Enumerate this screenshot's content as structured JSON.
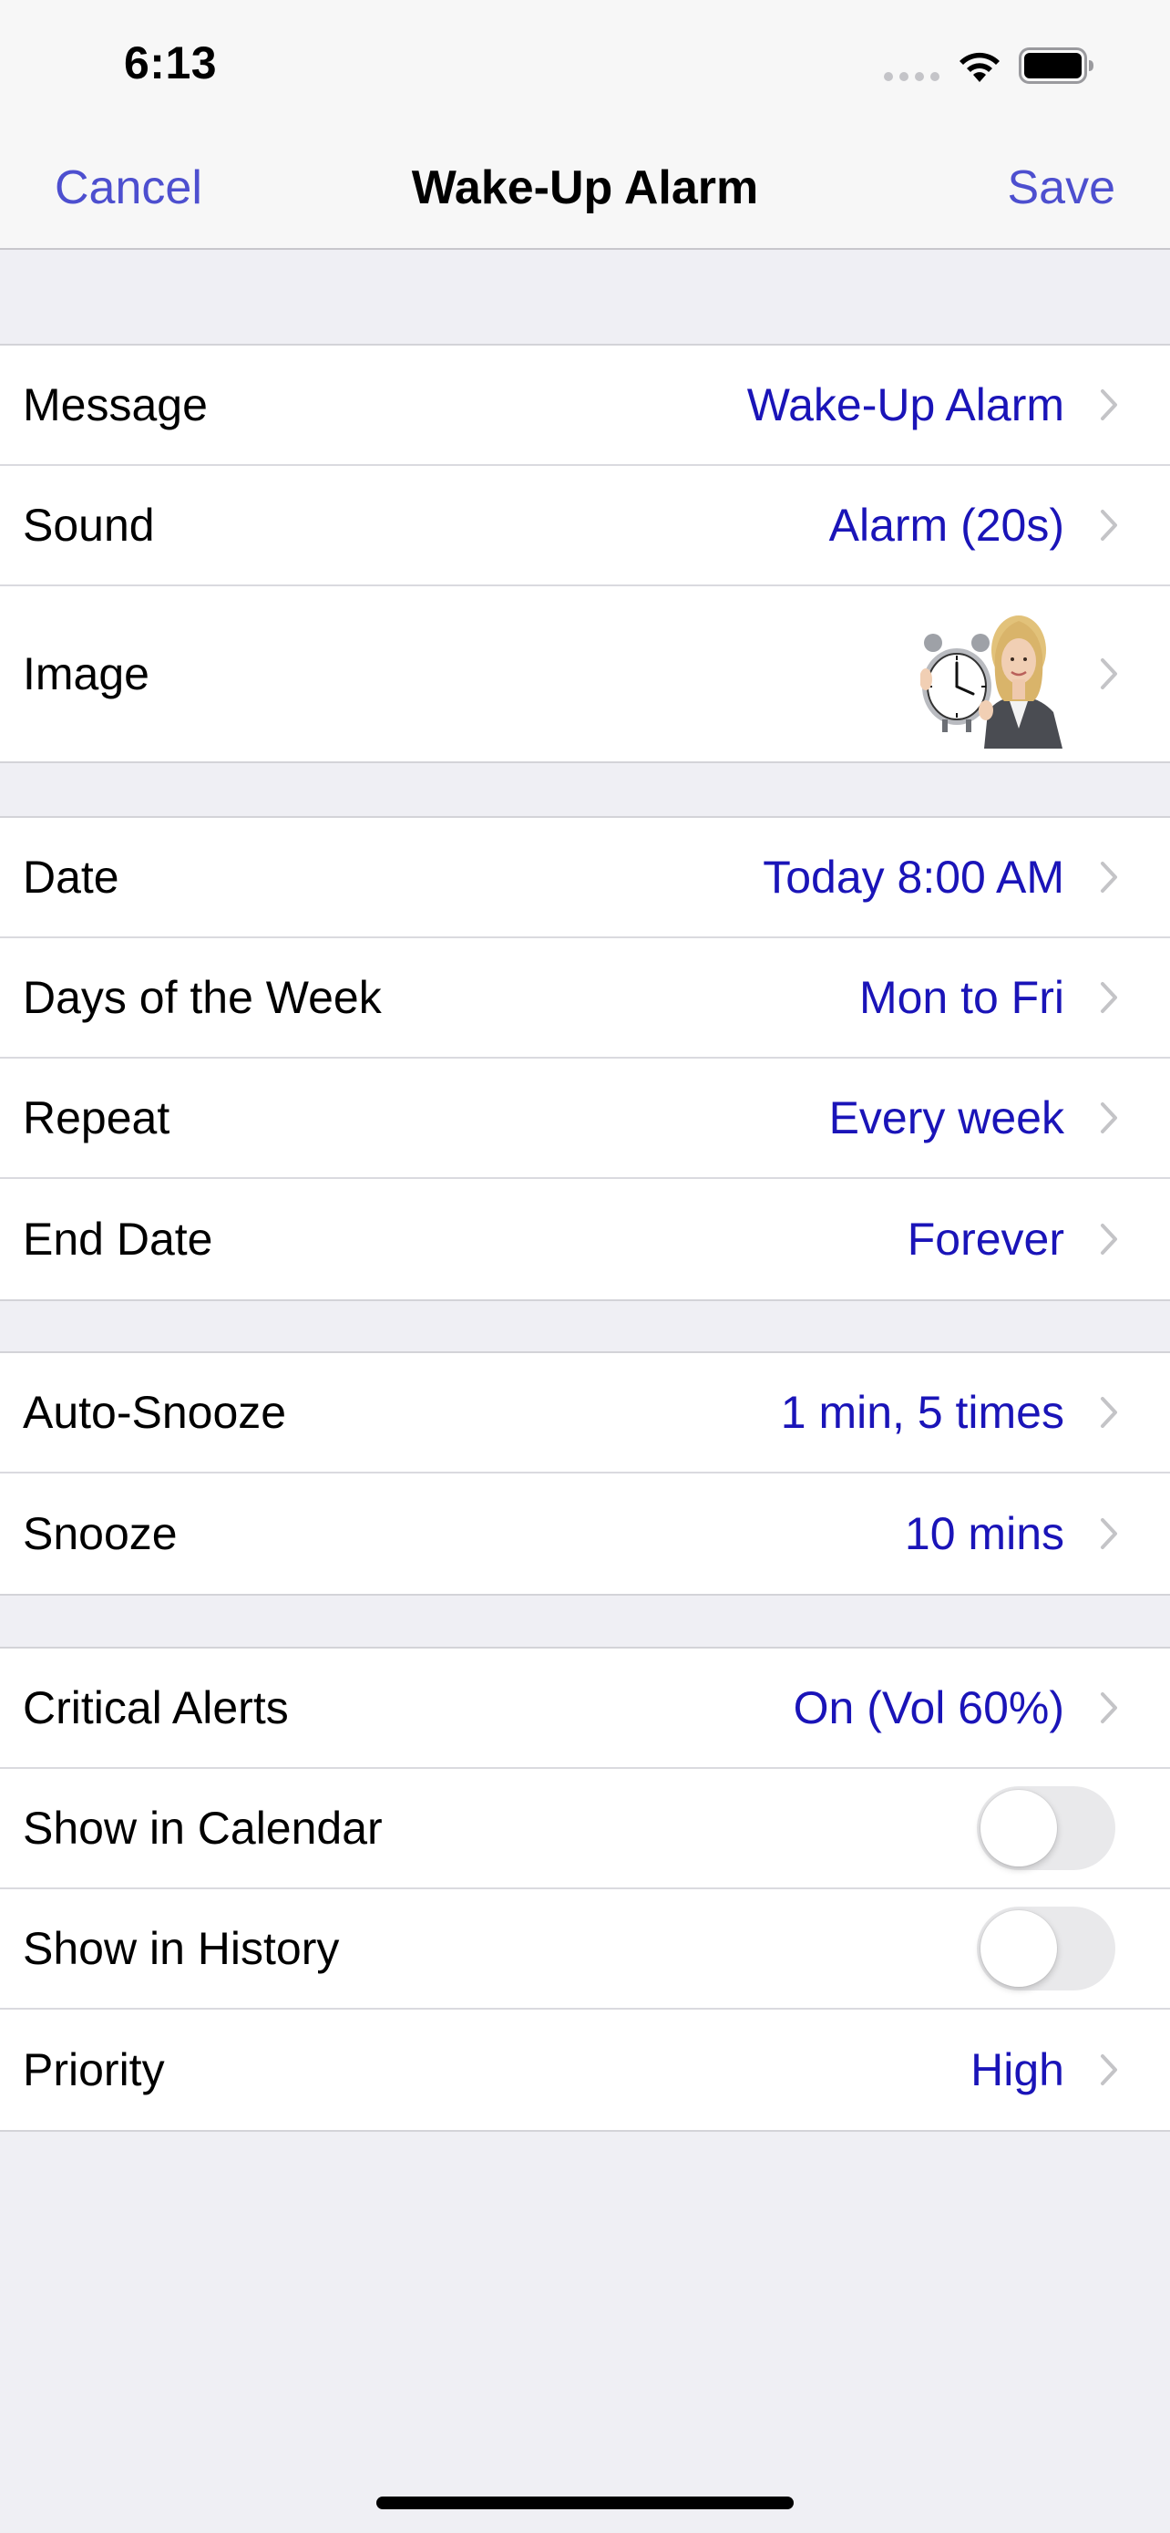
{
  "status_bar": {
    "time": "6:13"
  },
  "nav": {
    "cancel_label": "Cancel",
    "title": "Wake-Up Alarm",
    "save_label": "Save"
  },
  "colors": {
    "accent": "#4d4fcf",
    "value": "#1a14b8",
    "background": "#efeff4"
  },
  "groups": {
    "general": {
      "message": {
        "label": "Message",
        "value": "Wake-Up Alarm"
      },
      "sound": {
        "label": "Sound",
        "value": "Alarm (20s)"
      },
      "image": {
        "label": "Image",
        "icon": "alarm-clock-woman-photo"
      }
    },
    "schedule": {
      "date": {
        "label": "Date",
        "value": "Today 8:00 AM"
      },
      "days": {
        "label": "Days of the Week",
        "value": "Mon to Fri"
      },
      "repeat": {
        "label": "Repeat",
        "value": "Every week"
      },
      "end_date": {
        "label": "End Date",
        "value": "Forever"
      }
    },
    "snooze": {
      "auto_snooze": {
        "label": "Auto-Snooze",
        "value": "1 min, 5 times"
      },
      "snooze": {
        "label": "Snooze",
        "value": "10 mins"
      }
    },
    "options": {
      "critical_alerts": {
        "label": "Critical Alerts",
        "value": "On (Vol 60%)"
      },
      "show_in_calendar": {
        "label": "Show in Calendar",
        "on": false
      },
      "show_in_history": {
        "label": "Show in History",
        "on": false
      },
      "priority": {
        "label": "Priority",
        "value": "High"
      }
    }
  }
}
